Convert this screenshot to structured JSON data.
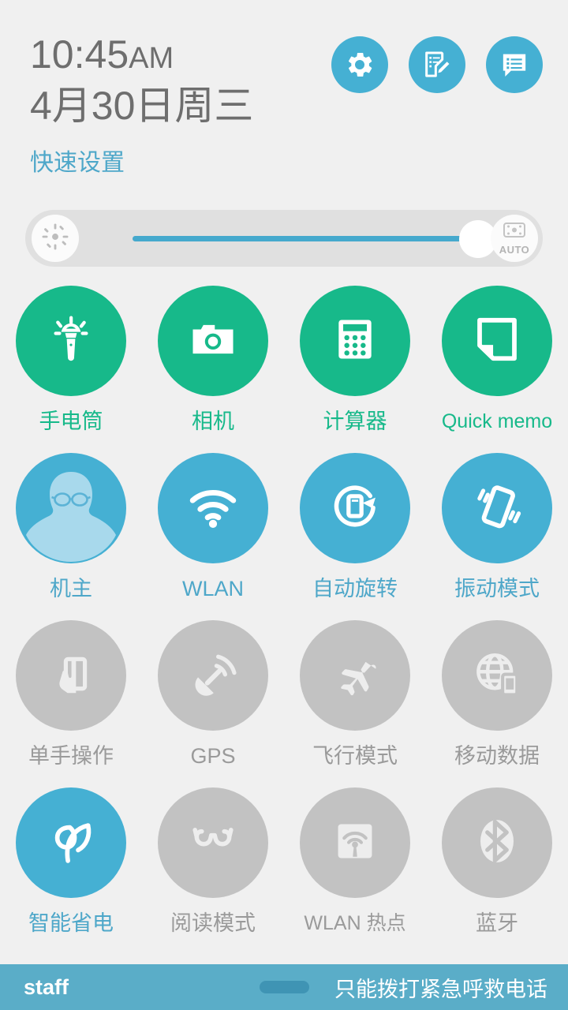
{
  "header": {
    "time": "10:45",
    "ampm": "AM",
    "date": "4月30日周三",
    "quick_settings_label": "快速设置",
    "icons": [
      {
        "name": "settings-gear-icon",
        "label": "设置"
      },
      {
        "name": "note-edit-icon",
        "label": "便签"
      },
      {
        "name": "message-list-icon",
        "label": "消息"
      }
    ]
  },
  "brightness": {
    "icon_name": "brightness-sun-icon",
    "auto_label": "AUTO",
    "value_percent": 97,
    "track_color": "#45a9cd"
  },
  "colors": {
    "background": "#f0f0f0",
    "green_active": "#17b98a",
    "blue_active": "#45b0d3",
    "grey_inactive": "#c2c2c2",
    "label_blue": "#4ea7c9",
    "label_grey": "#9a9a9a",
    "bottom_bar": "#5aadc8"
  },
  "tiles": [
    {
      "label": "手电筒",
      "icon": "flashlight-icon",
      "state": "green"
    },
    {
      "label": "相机",
      "icon": "camera-icon",
      "state": "green"
    },
    {
      "label": "计算器",
      "icon": "calculator-icon",
      "state": "green"
    },
    {
      "label": "Quick memo",
      "icon": "quick-memo-icon",
      "state": "green"
    },
    {
      "label": "机主",
      "icon": "owner-avatar-icon",
      "state": "blue"
    },
    {
      "label": "WLAN",
      "icon": "wifi-icon",
      "state": "blue"
    },
    {
      "label": "自动旋转",
      "icon": "auto-rotate-icon",
      "state": "blue"
    },
    {
      "label": "振动模式",
      "icon": "vibrate-icon",
      "state": "blue"
    },
    {
      "label": "单手操作",
      "icon": "one-hand-icon",
      "state": "grey"
    },
    {
      "label": "GPS",
      "icon": "gps-satellite-icon",
      "state": "grey"
    },
    {
      "label": "飞行模式",
      "icon": "airplane-icon",
      "state": "grey"
    },
    {
      "label": "移动数据",
      "icon": "mobile-data-icon",
      "state": "grey"
    },
    {
      "label": "智能省电",
      "icon": "power-save-leaf-icon",
      "state": "blue"
    },
    {
      "label": "阅读模式",
      "icon": "reading-glasses-icon",
      "state": "grey"
    },
    {
      "label": "WLAN 热点",
      "icon": "hotspot-icon",
      "state": "grey"
    },
    {
      "label": "蓝牙",
      "icon": "bluetooth-icon",
      "state": "grey"
    }
  ],
  "bottom": {
    "carrier": "staff",
    "status": "只能拨打紧急呼救电话",
    "handle_name": "drag-handle"
  }
}
